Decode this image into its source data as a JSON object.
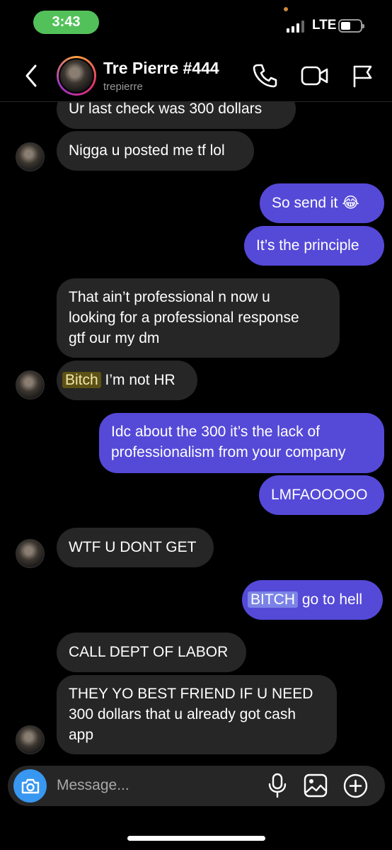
{
  "status_bar": {
    "time": "3:43",
    "network": "LTE"
  },
  "header": {
    "contact_name": "Tre Pierre #444",
    "username": "trepierre"
  },
  "messages": [
    {
      "dir": "in",
      "text": "Ur last check was 300 dollars"
    },
    {
      "dir": "in",
      "text": "Nigga u posted me tf lol"
    },
    {
      "dir": "out",
      "text": "So send it 😂"
    },
    {
      "dir": "out",
      "text": "It’s the principle"
    },
    {
      "dir": "in",
      "lines": [
        "That ain’t professional n now u",
        "looking for a professional response",
        "gtf our my dm"
      ]
    },
    {
      "dir": "in",
      "highlight": "Bitch",
      "text": " I’m not HR"
    },
    {
      "dir": "out",
      "lines": [
        "Idc about the 300 it’s the lack of",
        "professionalism from your company"
      ]
    },
    {
      "dir": "out",
      "text": "LMFAOOOOO"
    },
    {
      "dir": "in",
      "text": "WTF U DONT GET"
    },
    {
      "dir": "out",
      "highlight": "BITCH",
      "text": " go to hell"
    },
    {
      "dir": "in",
      "text": "CALL DEPT OF LABOR"
    },
    {
      "dir": "in",
      "lines": [
        "THEY YO BEST FRIEND IF U NEED",
        "300 dollars that u already got cash",
        "app"
      ]
    }
  ],
  "composer": {
    "placeholder": "Message..."
  },
  "colors": {
    "incoming_bubble": "#262626",
    "outgoing_bubble": "#5549d8",
    "camera_button": "#3897f0",
    "time_pill": "#53c15a"
  }
}
